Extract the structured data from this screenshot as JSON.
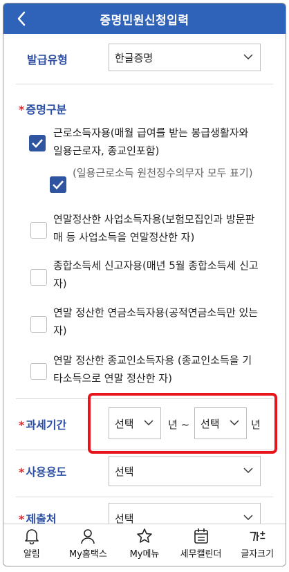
{
  "header": {
    "title": "증명민원신청입력"
  },
  "issue_type": {
    "label": "발급유형",
    "value": "한글증명"
  },
  "cert_section": {
    "label": "증명구분"
  },
  "options": [
    {
      "text": "근로소득자용(매월 급여를 받는 봉급생활자와 일용근로자, 종교인포함)",
      "checked": true
    },
    {
      "text": "(일용근로소득 원천징수의무자 모두 표기)",
      "checked": true
    },
    {
      "text": "연말정산한 사업소득자용(보험모집인과 방문판매 등 사업소득을 연말정산한 자)",
      "checked": false
    },
    {
      "text": "종합소득세 신고자용(매년 5월 종합소득세 신고자)",
      "checked": false
    },
    {
      "text": "연말 정산한 연금소득자용(공적연금소득만 있는 자)",
      "checked": false
    },
    {
      "text": "연말 정산한 종교인소득자용 (종교인소득을 기타소득으로 연말 정산한 자)",
      "checked": false
    }
  ],
  "tax_period": {
    "label": "과세기간",
    "start_value": "선택",
    "start_suffix": "년 ~",
    "end_value": "선택",
    "end_suffix": "년"
  },
  "usage": {
    "label": "사용용도",
    "value": "선택"
  },
  "submit_to": {
    "label": "제출처",
    "value": "선택"
  },
  "tabbar": [
    {
      "label": "알림",
      "icon": "bell-icon"
    },
    {
      "label": "My홈택스",
      "icon": "person-icon"
    },
    {
      "label": "My메뉴",
      "icon": "star-icon"
    },
    {
      "label": "세무캘린더",
      "icon": "calendar-icon"
    },
    {
      "label": "글자크기",
      "icon": "font-size-icon"
    }
  ]
}
